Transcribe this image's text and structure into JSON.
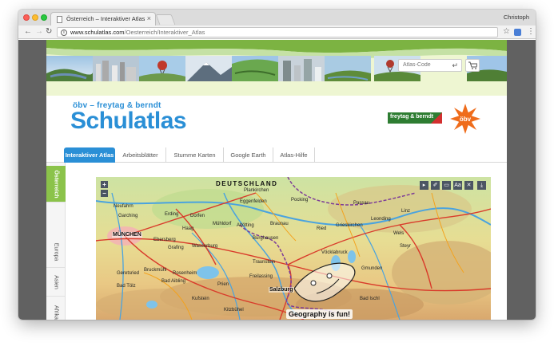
{
  "browser": {
    "tab_title": "Österreich – Interaktiver Atlas",
    "profile_name": "Christoph",
    "url_host": "www.schulatlas.com",
    "url_path": "/Oesterreich/Interaktiver_Atlas"
  },
  "header": {
    "atlas_code_placeholder": "Atlas-Code",
    "brand_sub": "öbv – freytag & berndt",
    "brand_title": "Schulatlas",
    "fb_logo_text": "freytag & berndt",
    "obv_logo_text": "öbv"
  },
  "nav": {
    "tabs": [
      {
        "label": "Interaktiver Atlas",
        "active": true
      },
      {
        "label": "Arbeitsblätter",
        "active": false
      },
      {
        "label": "Stumme Karten",
        "active": false
      },
      {
        "label": "Google Earth",
        "active": false
      },
      {
        "label": "Atlas-Hilfe",
        "active": false
      }
    ]
  },
  "sidebar": {
    "tabs": [
      {
        "label": "Österreich",
        "active": true
      },
      {
        "label": "Europa",
        "active": false
      },
      {
        "label": "Asien",
        "active": false
      },
      {
        "label": "Afrika",
        "active": false
      }
    ]
  },
  "map": {
    "zoom_in": "+",
    "zoom_out": "−",
    "tools": [
      "▸",
      "✐",
      "▭",
      "Aa",
      "✕",
      "⤓"
    ],
    "country_label": "DEUTSCHLAND",
    "city_label": "MÜNCHEN",
    "caption": "Geography is fun!",
    "places": [
      "Plankirchen",
      "Eggenfelden",
      "Pocking",
      "Passau",
      "Neufahrn",
      "Garching",
      "Erding",
      "Dorfen",
      "Altötting",
      "Braunau",
      "Ried",
      "Grieskirchen",
      "Linz",
      "Wels",
      "Leonding",
      "Haag",
      "Mühldorf",
      "Burghausen",
      "Ebersberg",
      "Grafing",
      "Wasserburg",
      "Traunstein",
      "Vöcklabruck",
      "Gmunden",
      "Steyr",
      "Rosenheim",
      "Bruckmühl",
      "Bad Aibling",
      "Prien",
      "Freilassing",
      "Salzburg",
      "Bad Ischl",
      "Bad Tölz",
      "Geretsried",
      "Kitzbühel",
      "Kufstein"
    ]
  },
  "colors": {
    "brand_blue": "#2a8fd6",
    "sidebar_active": "#8bc34a",
    "banner_green": "#8bc34a"
  }
}
